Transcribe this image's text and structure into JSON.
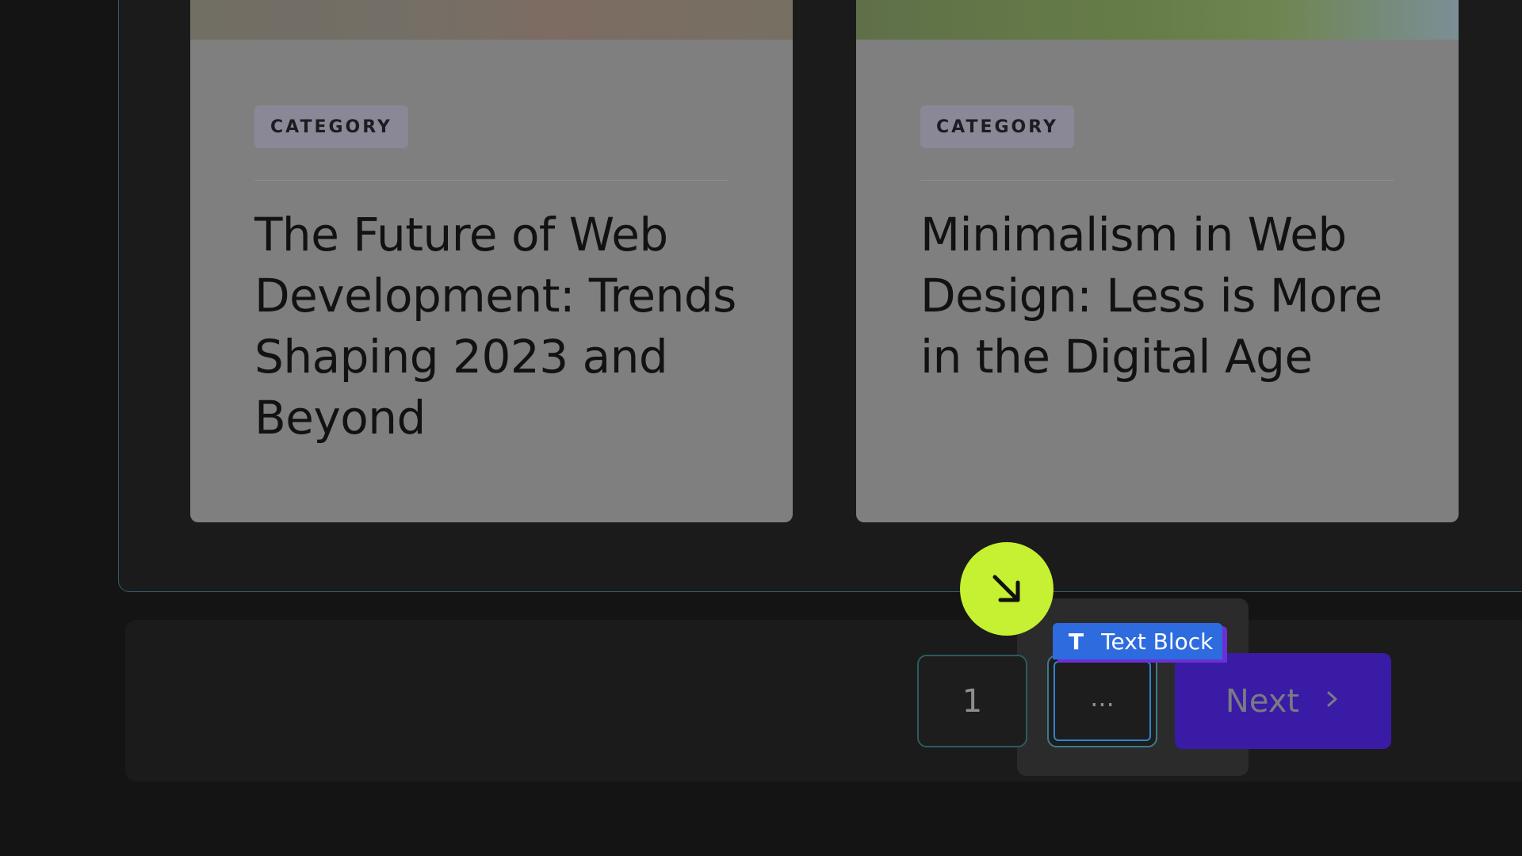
{
  "cards": [
    {
      "category": "CATEGORY",
      "title": "The Future of Web Development: Trends Shaping 2023 and Beyond"
    },
    {
      "category": "CATEGORY",
      "title": "Minimalism in Web Design: Less is More in the Digital Age"
    }
  ],
  "pagination": {
    "page_1": "1",
    "ellipsis": "...",
    "next_label": "Next",
    "next_icon": "chevron-right-icon"
  },
  "editor": {
    "selection_label": "Text Block",
    "selection_icon": "text-type-icon",
    "cursor_icon": "arrow-down-right-icon"
  },
  "colors": {
    "accent_next": "#3a1ba5",
    "selection_blue": "#2e6bde",
    "cursor_lime": "#c6f032"
  }
}
